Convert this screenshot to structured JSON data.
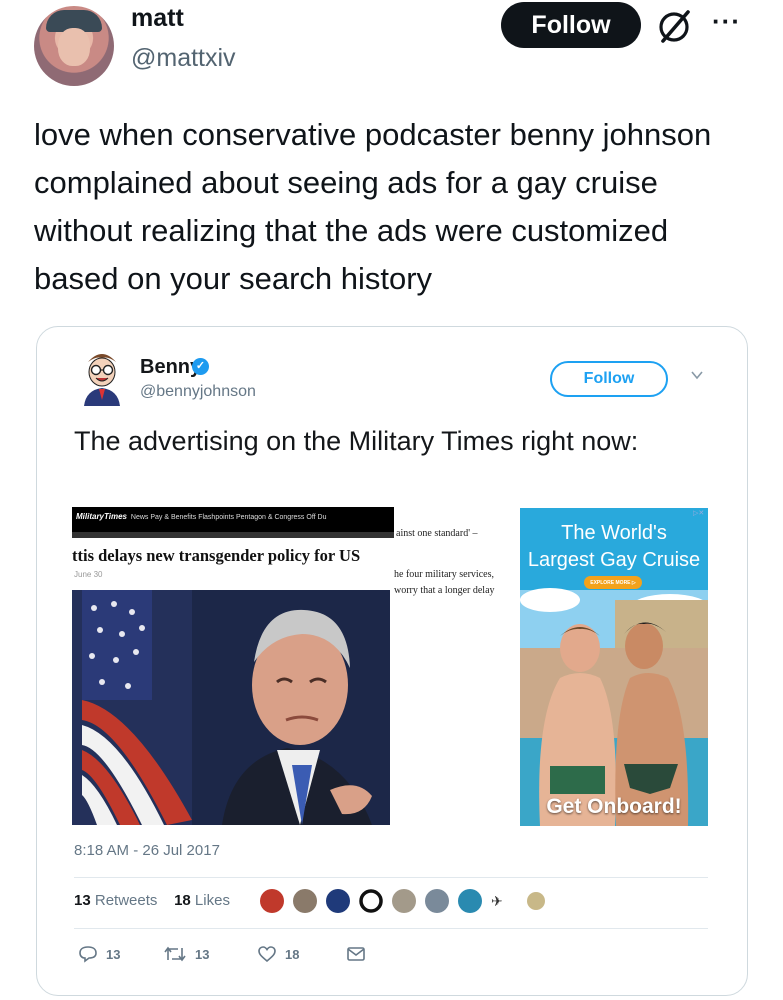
{
  "post": {
    "author_name": "matt",
    "author_handle": "@mattxiv",
    "follow_label": "Follow",
    "more_label": "···",
    "text": "love when conservative podcaster benny johnson complained about seeing ads for a gay cruise without realizing that the ads were customized based on your search history"
  },
  "embedded": {
    "author_name": "Benny",
    "author_handle": "@bennyjohnson",
    "verified_mark": "✓",
    "follow_label": "Follow",
    "text": "The advertising on the Military Times right now:",
    "timestamp": "8:18 AM - 26 Jul 2017",
    "retweets_count": "13",
    "retweets_label": "Retweets",
    "likes_count": "18",
    "likes_label": "Likes",
    "actions": {
      "reply_count": "13",
      "retweet_count": "13",
      "like_count": "18"
    }
  },
  "screenshot": {
    "site_logo_a": "Military",
    "site_logo_b": "Times",
    "nav_items": "News    Pay & Benefits    Flashpoints    Pentagon & Congress    Off Du",
    "headline": "ttis delays new transgender policy for US",
    "dateline": "June 30",
    "side_text_1": "ainst one standard' –",
    "side_text_2": "he four military services, worry that a longer delay",
    "ad": {
      "badge": "▷✕",
      "line1": "The World's",
      "line2": "Largest Gay Cruise",
      "explore": "EXPLORE MORE ▷",
      "cta": "Get Onboard!"
    }
  },
  "colors": {
    "follow_dark": "#0f1419",
    "twitter_blue": "#1da1f2",
    "muted": "#657786",
    "ad_blue": "#29a9dc",
    "ad_button": "#f3a21b"
  }
}
